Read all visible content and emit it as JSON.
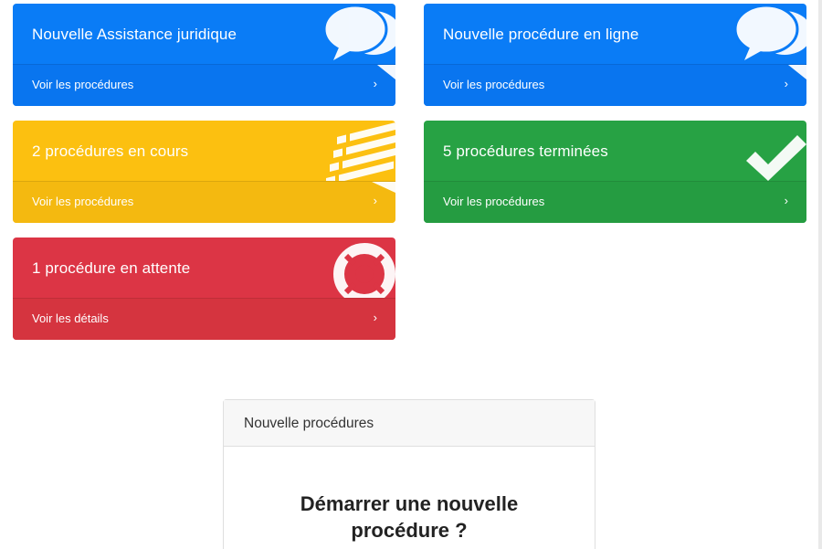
{
  "colors": {
    "blue": "#0a7cf6",
    "yellow": "#fcc010",
    "green": "#27a244",
    "red": "#dc3545"
  },
  "cards": [
    {
      "title": "Nouvelle Assistance juridique",
      "link": "Voir les procédures",
      "icon": "chat-bubbles-icon",
      "color": "blue"
    },
    {
      "title": "Nouvelle procédure en ligne",
      "link": "Voir les procédures",
      "icon": "chat-bubbles-icon",
      "color": "blue"
    },
    {
      "title": "2 procédures en cours",
      "link": "Voir les procédures",
      "icon": "list-icon",
      "color": "yellow"
    },
    {
      "title": "5 procédures terminées",
      "link": "Voir les procédures",
      "icon": "checkmark-icon",
      "color": "green"
    },
    {
      "title": "1 procédure en attente",
      "link": "Voir les détails",
      "icon": "lifebuoy-icon",
      "color": "red"
    }
  ],
  "chevron": "›",
  "panel": {
    "header": "Nouvelle procédures",
    "title_line1": "Démarrer une nouvelle",
    "title_line2": "procédure ?"
  }
}
